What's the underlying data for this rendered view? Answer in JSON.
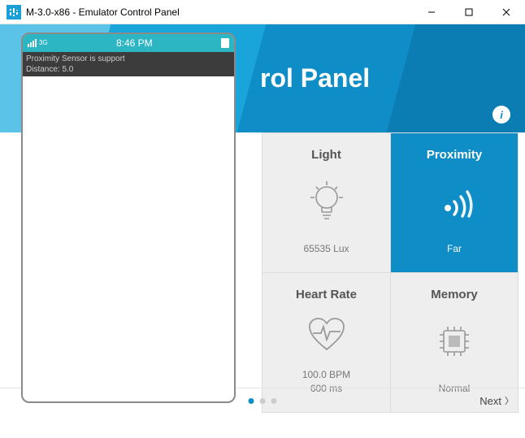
{
  "window": {
    "title": "M-3.0-x86 - Emulator Control Panel"
  },
  "banner": {
    "title_fragment": "rol Panel"
  },
  "phone": {
    "network": "3G",
    "time": "8:46 PM",
    "line1": "Proximity Sensor is support",
    "line2": "Distance: 5.0"
  },
  "tiles": {
    "light": {
      "title": "Light",
      "value": "65535 Lux"
    },
    "proximity": {
      "title": "Proximity",
      "value": "Far"
    },
    "heartrate": {
      "title": "Heart Rate",
      "value1": "100.0 BPM",
      "value2": "600 ms"
    },
    "memory": {
      "title": "Memory",
      "value": "Normal"
    }
  },
  "footer": {
    "next": "Next"
  }
}
